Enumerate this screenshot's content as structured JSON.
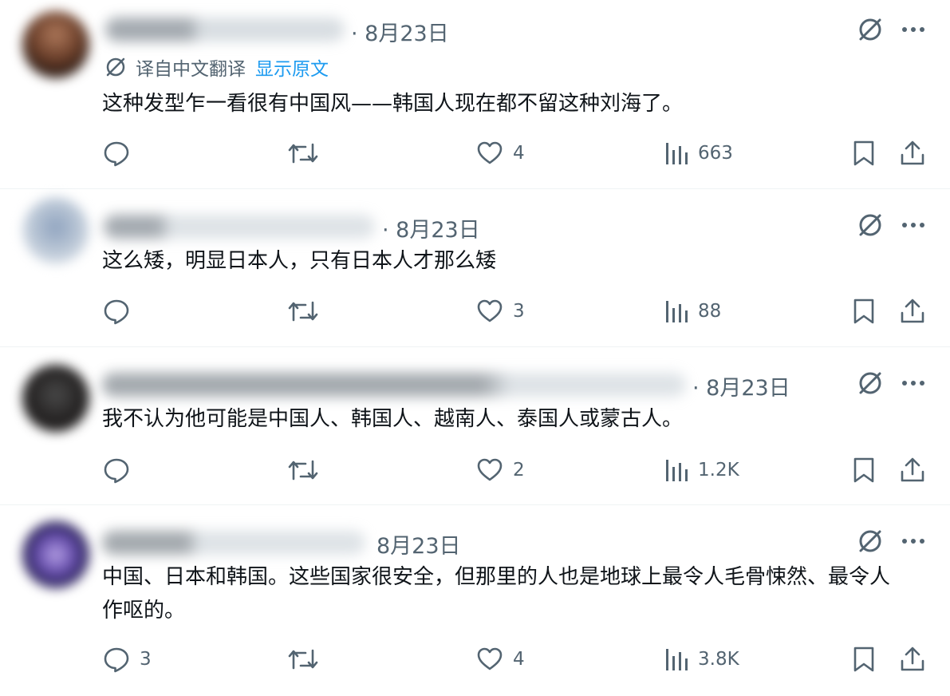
{
  "translation": {
    "label": "译自中文翻译",
    "show_original": "显示原文"
  },
  "colors": {
    "text": "#0f1419",
    "muted": "#536471",
    "link": "#1d9bf0",
    "divider": "#eff3f4"
  },
  "posts": [
    {
      "date": "· 8月23日",
      "text": "这种发型乍一看很有中国风——韩国人现在都不留这种刘海了。",
      "replies": "",
      "likes": "4",
      "views": "663"
    },
    {
      "date": "· 8月23日",
      "text": "这么矮，明显日本人，只有日本人才那么矮",
      "replies": "",
      "likes": "3",
      "views": "88"
    },
    {
      "date": "· 8月23日",
      "text": "我不认为他可能是中国人、韩国人、越南人、泰国人或蒙古人。",
      "replies": "",
      "likes": "2",
      "views": "1.2K"
    },
    {
      "date": "8月23日",
      "text": "中国、日本和韩国。这些国家很安全，但那里的人也是地球上最令人毛骨悚然、最令人作呕的。",
      "replies": "3",
      "likes": "4",
      "views": "3.8K"
    }
  ],
  "icons": [
    "grok-icon",
    "more-icon",
    "reply-icon",
    "retweet-icon",
    "like-icon",
    "views-icon",
    "bookmark-icon",
    "share-icon"
  ]
}
